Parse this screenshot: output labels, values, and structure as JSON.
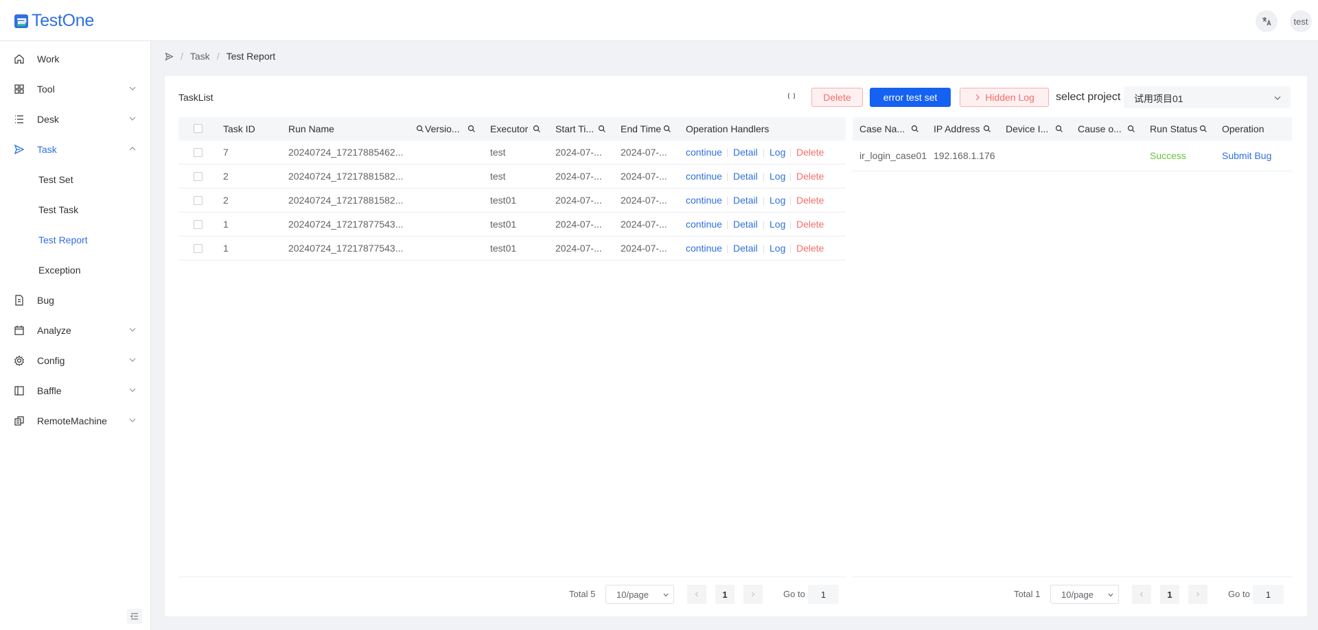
{
  "header": {
    "app_name": "TestOne",
    "lang_icon": "translate-icon",
    "user": "test"
  },
  "sidebar": {
    "items": [
      {
        "label": "Work",
        "icon": "home-icon"
      },
      {
        "label": "Tool",
        "icon": "grid-icon"
      },
      {
        "label": "Desk",
        "icon": "list-icon"
      },
      {
        "label": "Task",
        "icon": "send-icon"
      },
      {
        "label": "Bug",
        "icon": "document-icon"
      },
      {
        "label": "Analyze",
        "icon": "calendar-icon"
      },
      {
        "label": "Config",
        "icon": "gear-icon"
      },
      {
        "label": "Baffle",
        "icon": "panel-icon"
      },
      {
        "label": "RemoteMachine",
        "icon": "machine-icon"
      }
    ],
    "task_sub": [
      "Test Set",
      "Test Task",
      "Test Report",
      "Exception"
    ],
    "active_sub": "Test Report"
  },
  "breadcrumb": {
    "level1": "Task",
    "level2": "Test Report"
  },
  "toolbar": {
    "title": "TaskList",
    "delete_label": "Delete",
    "error_label": "error test set",
    "hidden_log_label": "Hidden Log",
    "select_label": "select project",
    "project_value": "试用项目01"
  },
  "left_table": {
    "headers": [
      "Task ID",
      "Run Name",
      "Versio...",
      "Executor",
      "Start Ti...",
      "End Time",
      "Operation Handlers"
    ],
    "rows": [
      {
        "id": "7",
        "run": "20240724_17217885462...",
        "version": "",
        "executor": "test",
        "start": "2024-07-...",
        "end": "2024-07-..."
      },
      {
        "id": "2",
        "run": "20240724_17217881582...",
        "version": "",
        "executor": "test",
        "start": "2024-07-...",
        "end": "2024-07-..."
      },
      {
        "id": "2",
        "run": "20240724_17217881582...",
        "version": "",
        "executor": "test01",
        "start": "2024-07-...",
        "end": "2024-07-..."
      },
      {
        "id": "1",
        "run": "20240724_17217877543...",
        "version": "",
        "executor": "test01",
        "start": "2024-07-...",
        "end": "2024-07-..."
      },
      {
        "id": "1",
        "run": "20240724_17217877543...",
        "version": "",
        "executor": "test01",
        "start": "2024-07-...",
        "end": "2024-07-..."
      }
    ],
    "actions": {
      "continue": "continue",
      "detail": "Detail",
      "log": "Log",
      "delete": "Delete"
    }
  },
  "right_table": {
    "headers": [
      "Case Na...",
      "IP Address",
      "Device I...",
      "Cause o...",
      "Run Status",
      "Operation"
    ],
    "rows": [
      {
        "case": "ir_login_case01",
        "ip": "192.168.1.176",
        "device": "",
        "cause": "",
        "status": "Success",
        "op": "Submit Bug"
      }
    ]
  },
  "pagination_left": {
    "total": "Total 5",
    "size": "10/page",
    "page": "1",
    "goto": "Go to",
    "goto_value": "1"
  },
  "pagination_right": {
    "total": "Total 1",
    "size": "10/page",
    "page": "1",
    "goto": "Go to",
    "goto_value": "1"
  },
  "colors": {
    "primary": "#1561f1",
    "link": "#2f6fe0",
    "danger": "#f56c6c",
    "success": "#67c23a"
  }
}
